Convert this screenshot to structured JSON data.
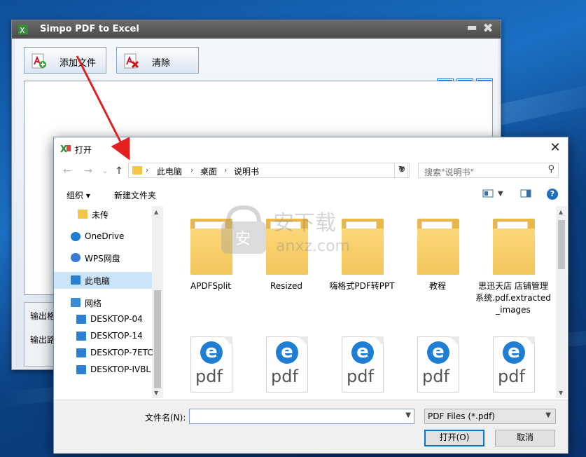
{
  "simpo": {
    "title": "Simpo PDF to Excel",
    "minimize_glyph": "▬",
    "close_glyph": "✖",
    "add_file_label": "添加文件",
    "clear_label": "清除",
    "tool_icon_glyph": "✚",
    "user_icon_glyph": "●",
    "info_icon_glyph": "!",
    "output_format_label": "输出格",
    "output_path_label": "输出路"
  },
  "dialog": {
    "title": "打开",
    "close_glyph": "✕",
    "back_glyph": "←",
    "forward_glyph": "→",
    "recent_glyph": "⌄",
    "up_glyph": "↑",
    "breadcrumb": [
      "此电脑",
      "桌面",
      "说明书"
    ],
    "breadcrumb_sep": "›",
    "search_placeholder": "搜索\"说明书\"",
    "organize_label": "组织 ▾",
    "new_folder_label": "新建文件夹",
    "nav_items": [
      {
        "label": "未传",
        "icon": "folder-icon"
      },
      {
        "label": "OneDrive",
        "icon": "cloud-icon"
      },
      {
        "label": "WPS网盘",
        "icon": "cloud-outline-icon"
      },
      {
        "label": "此电脑",
        "icon": "computer-icon"
      },
      {
        "label": "网络",
        "icon": "network-icon"
      },
      {
        "label": "DESKTOP-04",
        "icon": "monitor-icon"
      },
      {
        "label": "DESKTOP-14",
        "icon": "monitor-icon"
      },
      {
        "label": "DESKTOP-7ETC",
        "icon": "monitor-icon"
      },
      {
        "label": "DESKTOP-IVBL",
        "icon": "monitor-icon"
      }
    ],
    "files": [
      {
        "name": "APDFSplit",
        "type": "folder"
      },
      {
        "name": "Resized",
        "type": "folder"
      },
      {
        "name": "嗨格式PDF转PPT",
        "type": "folder"
      },
      {
        "name": "教程",
        "type": "folder"
      },
      {
        "name": "思迅天店 店铺管理系统.pdf.extracted_images",
        "type": "folder"
      },
      {
        "name": "",
        "type": "pdf"
      },
      {
        "name": "",
        "type": "pdf"
      },
      {
        "name": "",
        "type": "pdf"
      },
      {
        "name": "",
        "type": "pdf"
      },
      {
        "name": "",
        "type": "pdf"
      }
    ],
    "pdf_glyph": "e",
    "pdf_text": "pdf",
    "filename_label": "文件名(N):",
    "filename_value": "",
    "filetype_value": "PDF Files (*.pdf)",
    "open_button": "打开(O)",
    "cancel_button": "取消",
    "help_glyph": "?"
  },
  "colors": {
    "accent": "#0078d7",
    "arrow": "#e32020"
  }
}
